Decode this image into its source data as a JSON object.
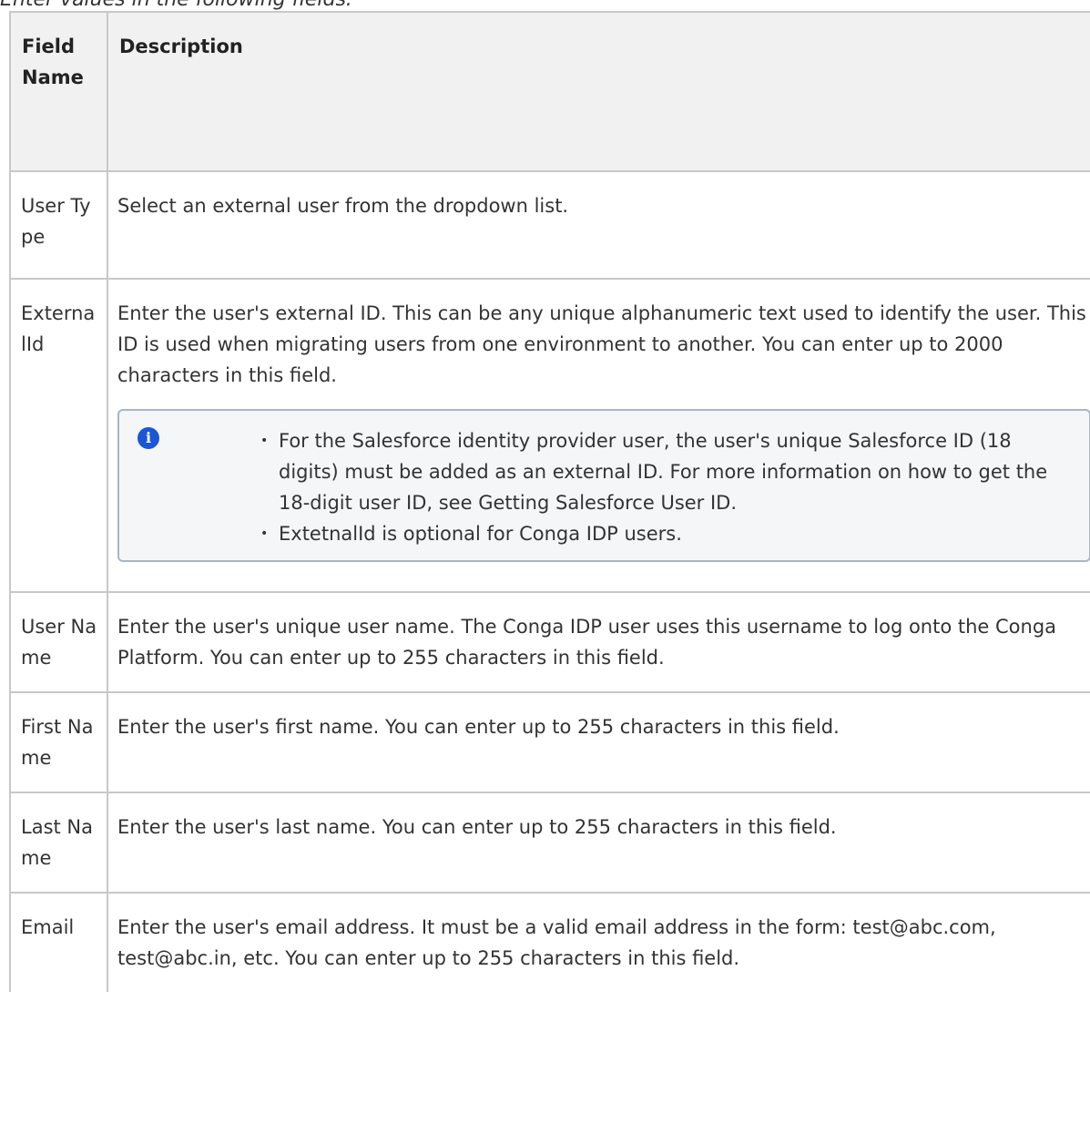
{
  "intro_text": "Enter values in the following fields:",
  "table": {
    "headers": [
      "Field Name",
      "Description"
    ],
    "rows": [
      {
        "name": "User Type",
        "description": "Select an external user from the dropdown list."
      },
      {
        "name": "ExternalId",
        "description": "Enter the user's external ID. This can be any unique alphanumeric text used to identify the user. This ID is used when migrating users from one environment to another. You can enter up to 2000 characters in this field.",
        "note": [
          "For the Salesforce identity provider user, the user's unique Salesforce ID (18 digits) must be added as an external ID. For more information on how to get the 18-digit user ID, see Getting Salesforce User ID.",
          "ExtetnalId is optional for Conga IDP users."
        ]
      },
      {
        "name": "User Name",
        "description": "Enter the user's unique user name. The Conga IDP user uses this username to log onto the Conga Platform. You can enter up to 255 characters in this field."
      },
      {
        "name": "First Name",
        "description": "Enter the user's first name. You can enter up to 255 characters in this field."
      },
      {
        "name": "Last Name",
        "description": "Enter the user's last name. You can enter up to 255 characters in this field."
      },
      {
        "name": "Email",
        "description": "Enter the user's email address. It must be a valid email address in the form: test@abc.com, test@abc.in, etc. You can enter up to 255 characters in this field."
      }
    ]
  },
  "icons": {
    "note_icon": "info-icon"
  },
  "colors": {
    "info_icon": "#1a56d6",
    "header_bg": "#f1f1f1",
    "note_bg": "#f4f6f8",
    "note_border": "#a9b6c3",
    "border": "#c8c8c8"
  }
}
